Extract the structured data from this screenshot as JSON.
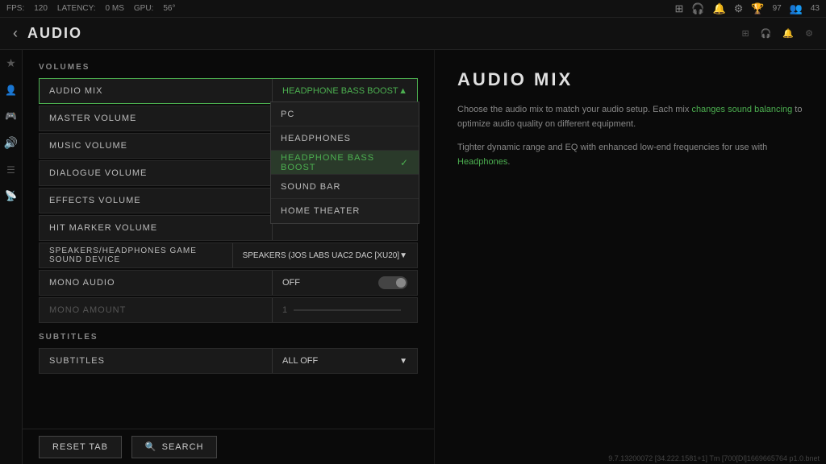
{
  "topbar": {
    "fps_label": "FPS:",
    "fps_value": "120",
    "latency_label": "LATENCY:",
    "latency_value": "0 MS",
    "gpu_label": "GPU:",
    "gpu_value": "56°",
    "icons": [
      "grid",
      "headphones",
      "bell",
      "gear",
      "trophy"
    ],
    "score1": "97",
    "score2": "43"
  },
  "header": {
    "back": "‹",
    "title": "AUDIO"
  },
  "sidebar": {
    "icons": [
      "★",
      "🎮",
      "✏",
      "🔊",
      "☰",
      "📡"
    ]
  },
  "sections": {
    "volumes_label": "VOLUMES",
    "subtitles_label": "SUBTITLES"
  },
  "settings": {
    "audio_mix": {
      "label": "AUDIO MIX",
      "value": "HEADPHONE BASS BOOST",
      "highlighted": true
    },
    "master_volume": {
      "label": "MASTER VOLUME",
      "has_star": true
    },
    "music_volume": {
      "label": "MUSIC VOLUME"
    },
    "dialogue_volume": {
      "label": "DIALOGUE VOLUME"
    },
    "effects_volume": {
      "label": "EFFECTS VOLUME"
    },
    "hit_marker_volume": {
      "label": "HIT MARKER VOLUME"
    },
    "sound_device": {
      "label": "SPEAKERS/HEADPHONES GAME SOUND DEVICE",
      "value": "SPEAKERS (JOS LABS UAC2 DAC [XU20]"
    },
    "mono_audio": {
      "label": "MONO AUDIO",
      "value": "OFF"
    },
    "mono_amount": {
      "label": "MONO AMOUNT",
      "value": "1",
      "dimmed": true
    },
    "subtitles": {
      "label": "SUBTITLES",
      "value": "ALL OFF"
    }
  },
  "dropdown": {
    "items": [
      {
        "label": "PC",
        "selected": false
      },
      {
        "label": "HEADPHONES",
        "selected": false
      },
      {
        "label": "HEADPHONE BASS BOOST",
        "selected": true
      },
      {
        "label": "SOUND BAR",
        "selected": false
      },
      {
        "label": "HOME THEATER",
        "selected": false
      }
    ]
  },
  "right_panel": {
    "title": "AUDIO MIX",
    "desc1_part1": "Choose the audio mix to match your audio setup. Each mix ",
    "desc1_link": "changes sound balancing",
    "desc1_part2": " to optimize audio quality on different equipment.",
    "desc2_part1": "Tighter dynamic range and EQ with enhanced low-end frequencies for use with ",
    "desc2_link": "Headphones",
    "desc2_part2": "."
  },
  "buttons": {
    "reset_tab": "RESET TAB",
    "search": "SEARCH"
  },
  "footer": {
    "info": "9.7.13200072 [34.222.1581+1] Tm [700[Dl]1669665764 p1.0.bnet"
  }
}
